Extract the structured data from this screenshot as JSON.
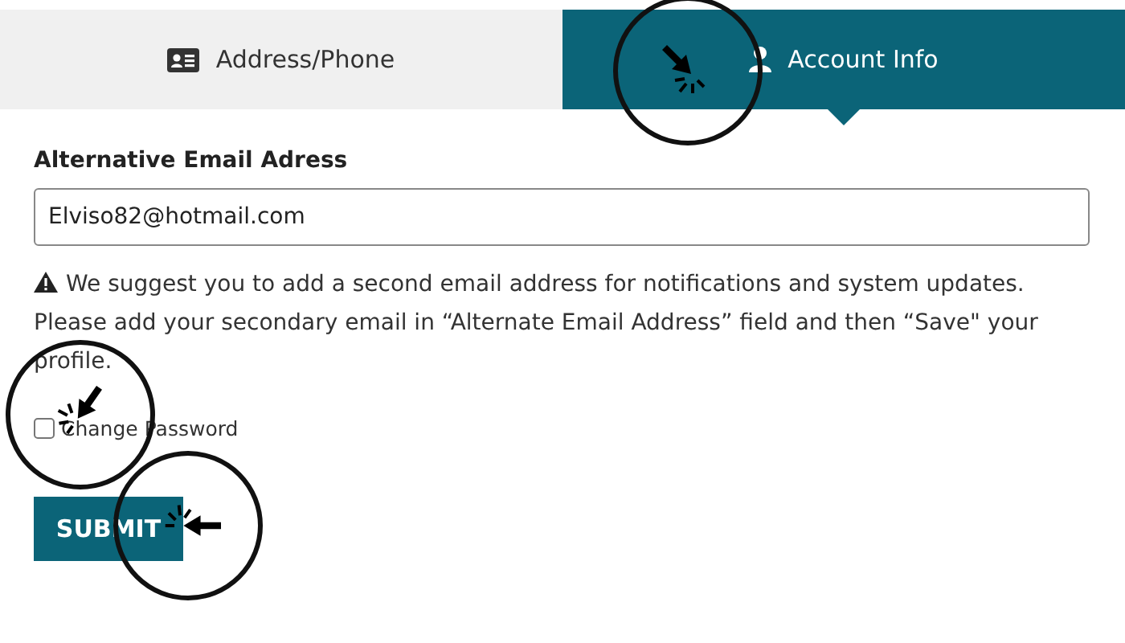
{
  "tabs": [
    {
      "label": "Address/Phone",
      "kind": "address",
      "selected": false
    },
    {
      "label": "Account Info",
      "kind": "account",
      "selected": true
    }
  ],
  "email_field": {
    "label": "Alternative Email Adress",
    "value": "Elviso82@hotmail.com"
  },
  "notice": "We suggest you to add a second email address for notifications and system updates. Please add your secondary email in “Alternate Email Address” field and then “Save\" your profile.",
  "change_password": {
    "label": "Change Password",
    "checked": false
  },
  "submit": "SUBMIT"
}
